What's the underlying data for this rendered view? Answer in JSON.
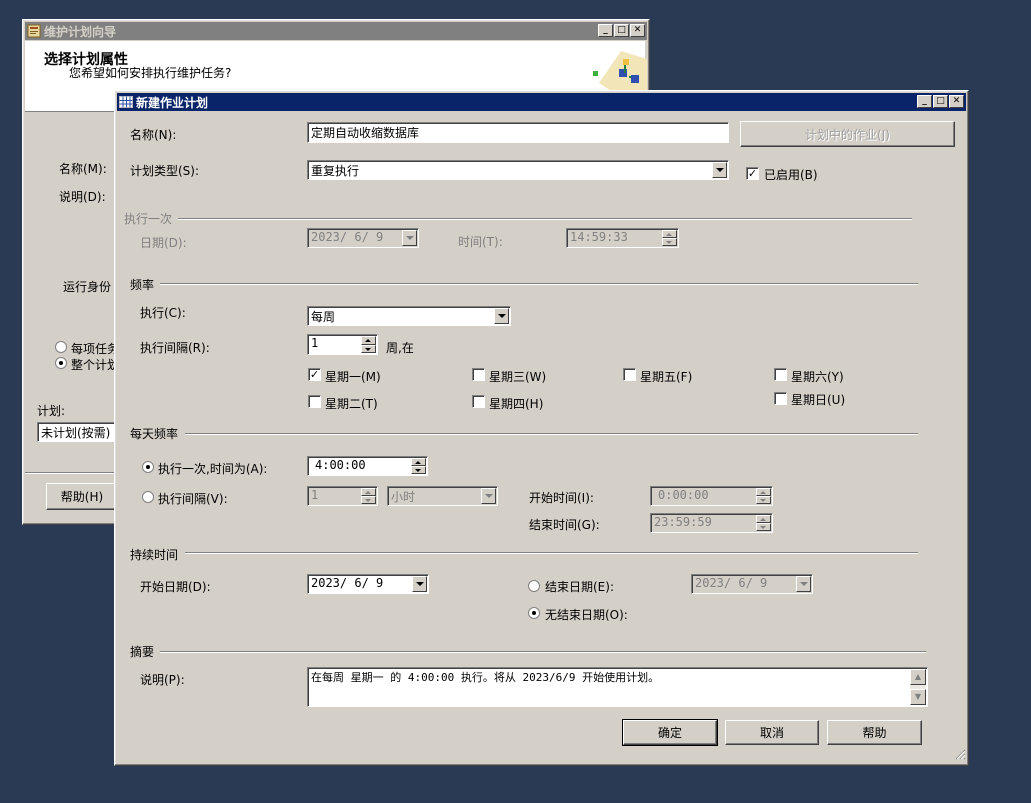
{
  "back_window": {
    "title": "维护计划向导",
    "header_title": "选择计划属性",
    "header_subtitle": "您希望如何安排执行维护任务?",
    "name_label": "名称(M):",
    "desc_label": "说明(D):",
    "run_as_label": "运行身份",
    "radio_each": "每项任务",
    "radio_whole": "整个计划",
    "schedule_label": "计划:",
    "schedule_value": "未计划(按需)",
    "help_button": "帮助(H)"
  },
  "dialog": {
    "title": "新建作业计划",
    "name_label": "名称(N):",
    "name_value": "定期自动收缩数据库",
    "jobs_button": "计划中的作业(J)",
    "type_label": "计划类型(S):",
    "type_value": "重复执行",
    "enabled_label": "已启用(B)",
    "enabled_checked": true,
    "once": {
      "group": "执行一次",
      "date_label": "日期(D):",
      "date_value": "2023/ 6/ 9",
      "time_label": "时间(T):",
      "time_value": "14:59:33"
    },
    "frequency": {
      "group": "频率",
      "occurs_label": "执行(C):",
      "occurs_value": "每周",
      "interval_label": "执行间隔(R):",
      "interval_value": "1",
      "interval_unit": "周,在",
      "days": {
        "mon": "星期一(M)",
        "tue": "星期二(T)",
        "wed": "星期三(W)",
        "thu": "星期四(H)",
        "fri": "星期五(F)",
        "sat": "星期六(Y)",
        "sun": "星期日(U)"
      },
      "checked_day": "mon"
    },
    "daily": {
      "group": "每天频率",
      "once_label": "执行一次,时间为(A):",
      "once_value": "4:00:00",
      "every_label": "执行间隔(V):",
      "every_value": "1",
      "every_unit": "小时",
      "start_label": "开始时间(I):",
      "start_value": "0:00:00",
      "end_label": "结束时间(G):",
      "end_value": "23:59:59"
    },
    "duration": {
      "group": "持续时间",
      "start_label": "开始日期(D):",
      "start_value": "2023/ 6/ 9",
      "end_label": "结束日期(E):",
      "end_value": "2023/ 6/ 9",
      "no_end_label": "无结束日期(O):"
    },
    "summary": {
      "group": "摘要",
      "desc_label": "说明(P):",
      "desc_value": "在每周 星期一 的 4:00:00 执行。将从 2023/6/9 开始使用计划。"
    },
    "ok": "确定",
    "cancel": "取消",
    "help": "帮助"
  }
}
